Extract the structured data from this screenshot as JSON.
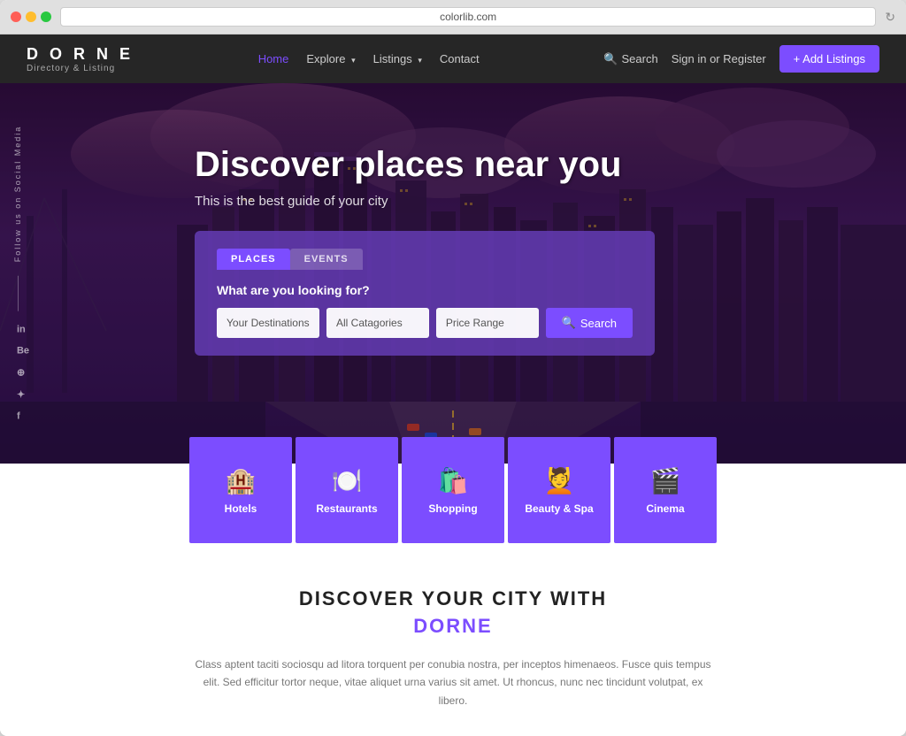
{
  "browser": {
    "address": "colorlib.com",
    "refresh_icon": "↻"
  },
  "navbar": {
    "brand_name": "D O R N E",
    "brand_sub": "Directory & Listing",
    "nav_items": [
      {
        "label": "Home",
        "active": true,
        "has_dropdown": false
      },
      {
        "label": "Explore",
        "active": false,
        "has_dropdown": true
      },
      {
        "label": "Listings",
        "active": false,
        "has_dropdown": true
      },
      {
        "label": "Contact",
        "active": false,
        "has_dropdown": false
      }
    ],
    "search_label": "Search",
    "signin_label": "Sign in or Register",
    "add_listing_label": "+ Add Listings"
  },
  "hero": {
    "title": "Discover places near you",
    "subtitle": "This is the best guide of your city",
    "social_label": "Follow us on Social Media",
    "social_links": [
      "in",
      "Be",
      "⊕",
      "✦",
      "f"
    ],
    "search_box": {
      "label": "What are you looking for?",
      "tab_places": "PLACES",
      "tab_events": "EVENTS",
      "destination_placeholder": "Your Destinations",
      "categories_placeholder": "All Catagories",
      "price_placeholder": "Price Range",
      "search_btn": "Search"
    }
  },
  "categories": [
    {
      "label": "Hotels",
      "icon": "🏨"
    },
    {
      "label": "Restaurants",
      "icon": "🍽️"
    },
    {
      "label": "Shopping",
      "icon": "🛍️"
    },
    {
      "label": "Beauty & Spa",
      "icon": "💆"
    },
    {
      "label": "Cinema",
      "icon": "🎬"
    }
  ],
  "discover": {
    "title": "DISCOVER YOUR CITY WITH",
    "brand": "DORNE",
    "description": "Class aptent taciti sociosqu ad litora torquent per conubia nostra, per inceptos himenaeos. Fusce quis tempus elit. Sed efficitur tortor neque, vitae aliquet urna varius sit amet. Ut rhoncus, nunc nec tincidunt volutpat, ex libero."
  },
  "colors": {
    "accent": "#7c4dff",
    "dark": "#1a0a2a",
    "text_light": "#ffffff"
  }
}
